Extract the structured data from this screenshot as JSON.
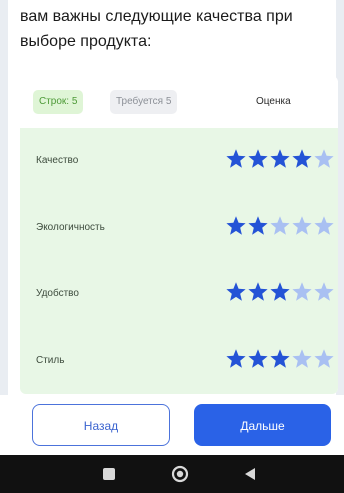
{
  "question": {
    "text": "вам важны следующие качества при\nвыборе продукта:"
  },
  "table": {
    "rows_chip": "Строк: 5",
    "required_chip": "Требуется 5",
    "rating_column": "Оценка",
    "max_stars": 5,
    "rows": [
      {
        "label": "Качество",
        "rating": 4
      },
      {
        "label": "Экологичность",
        "rating": 2
      },
      {
        "label": "Удобство",
        "rating": 3
      },
      {
        "label": "Стиль",
        "rating": 3
      }
    ]
  },
  "footer": {
    "back_label": "Назад",
    "next_label": "Дальше"
  },
  "system_nav": {
    "recents_icon": "square-icon",
    "home_icon": "circle-icon",
    "back_icon": "triangle-back-icon"
  },
  "colors": {
    "accent": "#2a62e7",
    "star_filled": "#2453d6",
    "star_empty": "#a9c0f2",
    "row_background": "#e8f7e6",
    "rows_chip_background": "#dff5d6"
  }
}
